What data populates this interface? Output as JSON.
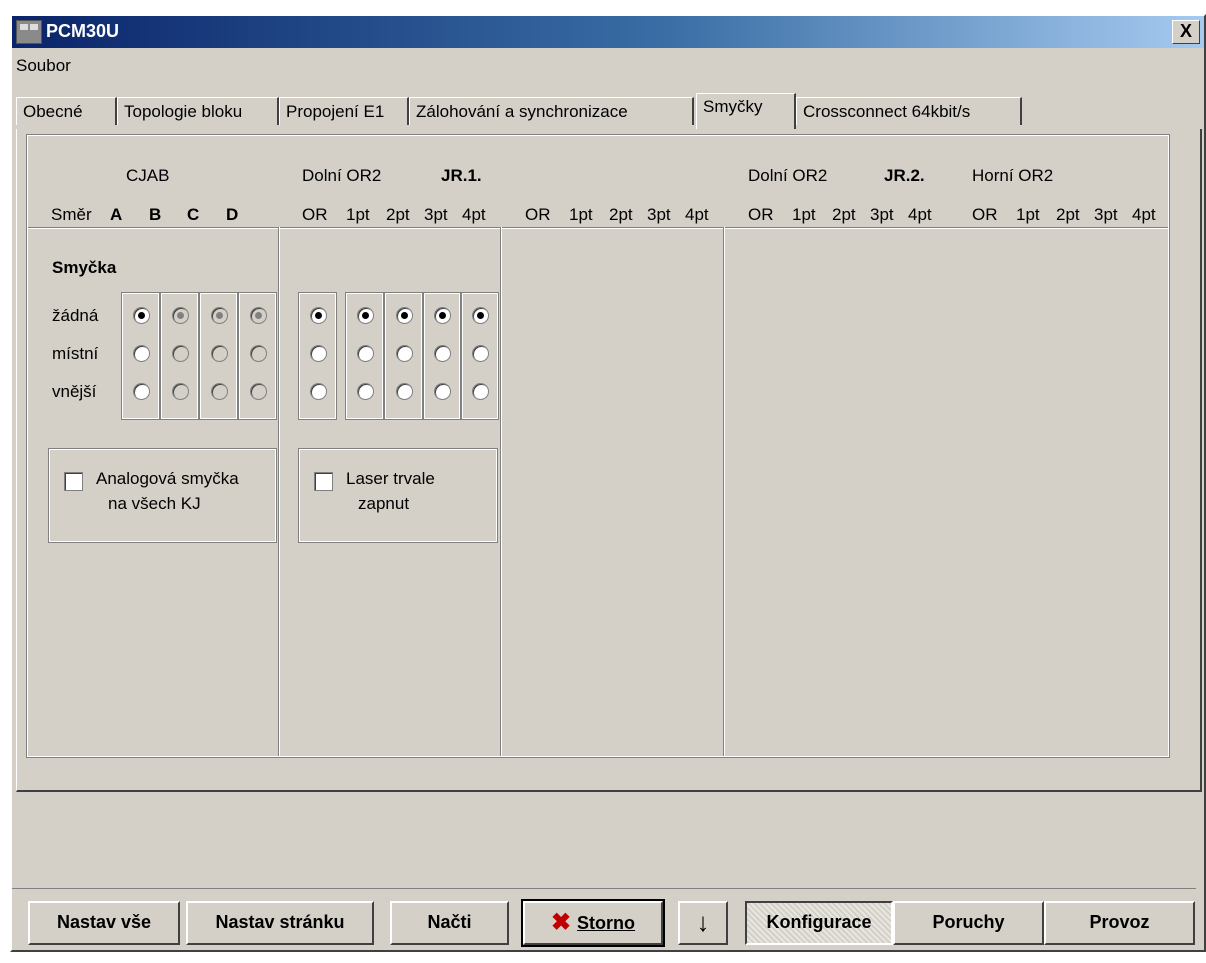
{
  "window": {
    "title": "PCM30U",
    "close_label": "X"
  },
  "menu": {
    "file": "Soubor"
  },
  "tabs": [
    "Obecné",
    "Topologie bloku",
    "Propojení E1",
    "Zálohování a synchronizace",
    "Smyčky",
    "Crossconnect 64kbit/s"
  ],
  "active_tab": "Smyčky",
  "header": {
    "cjab": "CJAB",
    "smer": "Směr",
    "abcd": [
      "A",
      "B",
      "C",
      "D"
    ],
    "dolni1": "Dolní OR2",
    "jr1": "JR.1.",
    "dolni2": "Dolní OR2",
    "jr2": "JR.2.",
    "horni": "Horní OR2",
    "cols": [
      "OR",
      "1pt",
      "2pt",
      "3pt",
      "4pt"
    ]
  },
  "loop": {
    "title": "Smyčka",
    "rows": [
      "žádná",
      "místní",
      "vnější"
    ],
    "analog_line1": "Analogová smyčka",
    "analog_line2": "na všech KJ",
    "laser_line1": "Laser trvale",
    "laser_line2": "zapnut"
  },
  "buttons": {
    "set_all": "Nastav vše",
    "set_page": "Nastav stránku",
    "read": "Načti",
    "cancel": "Storno",
    "down": "↓",
    "config": "Konfigurace",
    "faults": "Poruchy",
    "operation": "Provoz"
  }
}
